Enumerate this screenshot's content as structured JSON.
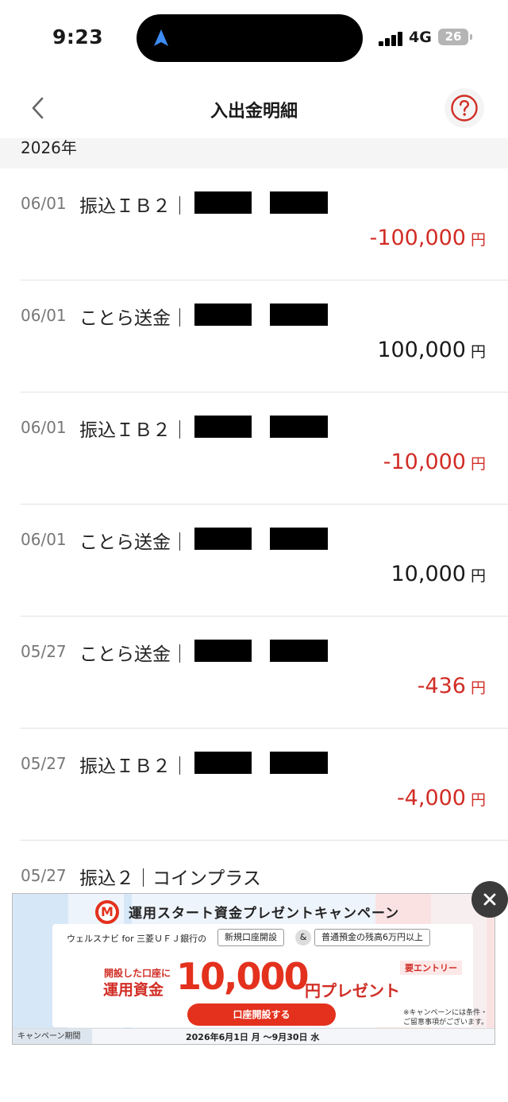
{
  "status_bar": {
    "time": "9:23",
    "network": "4G",
    "battery": "26"
  },
  "header": {
    "title": "入出金明細"
  },
  "year_section": "2026年",
  "currency_unit": "円",
  "transactions": [
    {
      "date": "06/01",
      "description": "振込ＩＢ２｜",
      "amount": "-100,000",
      "sign": "negative"
    },
    {
      "date": "06/01",
      "description": "ことら送金｜",
      "amount": "100,000",
      "sign": "positive"
    },
    {
      "date": "06/01",
      "description": "振込ＩＢ２｜",
      "amount": "-10,000",
      "sign": "negative"
    },
    {
      "date": "06/01",
      "description": "ことら送金｜",
      "amount": "10,000",
      "sign": "positive"
    },
    {
      "date": "05/27",
      "description": "ことら送金｜",
      "amount": "-436",
      "sign": "negative"
    },
    {
      "date": "05/27",
      "description": "振込ＩＢ２｜",
      "amount": "-4,000",
      "sign": "negative"
    },
    {
      "date": "05/27",
      "description": "振込２｜コインプラス",
      "amount": "",
      "sign": "none"
    }
  ],
  "ad": {
    "logo_letter": "M",
    "title": "運用スタート資金プレゼントキャンペーン",
    "subtitle": "ウェルスナビ for 三菱ＵＦＪ銀行の",
    "tag1": "新規口座開設",
    "amp": "&",
    "tag2": "普通預金の残高6万円以上",
    "lead1": "開設した口座に",
    "lead2": "運用資金",
    "big_amount": "10,000",
    "yen_present": "円プレゼント",
    "entry": "要エントリー",
    "cta": "口座開設する",
    "note_line1": "※キャンペーンには条件・",
    "note_line2": "ご留意事項がございます。",
    "period_label": "キャンペーン期間",
    "period": "2026年6月1日 月 ～9月30日 水"
  },
  "colors": {
    "negative": "#d12d25",
    "accent": "#e3311d",
    "divider": "#e2e2e2"
  },
  "icons": {
    "back": "chevron-left-icon",
    "help": "question-circle-icon",
    "close": "close-icon",
    "location": "location-arrow-icon"
  }
}
